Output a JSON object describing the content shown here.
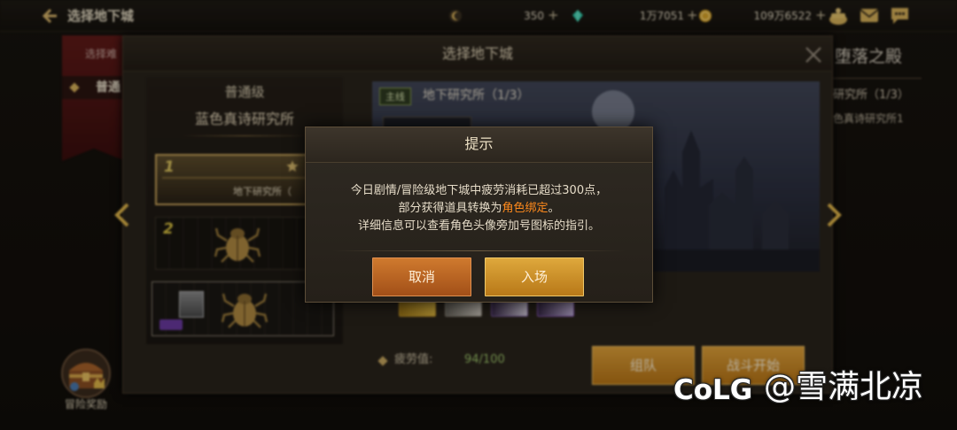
{
  "top_bar": {
    "title": "选择地下城",
    "currencies": [
      {
        "icon": "moon-coin-icon",
        "value": "350",
        "add": "+"
      },
      {
        "icon": "gem-icon",
        "value": "1万7051",
        "add": "+"
      },
      {
        "icon": "gold-coin-icon",
        "value": "109万6522",
        "add": "+"
      }
    ],
    "right_icons": [
      "treasure-pot-icon",
      "mail-icon",
      "chat-icon"
    ]
  },
  "left_banner": {
    "heading": "选择难",
    "difficulty": "普通"
  },
  "right_preview": {
    "title": "堕落之殿",
    "stage": "研究所（1/3）",
    "dungeon": "色真诗研究所1"
  },
  "dungeon_panel": {
    "title": "选择地下城",
    "difficulty": "普通级",
    "dungeon_name": "蓝色真诗研究所",
    "cards": [
      {
        "number": "1",
        "label": "地下研究所（"
      },
      {
        "number": "2"
      }
    ],
    "tag": "主线",
    "stage": "地下研究所（1/3）",
    "fatigue_label": "疲劳值:",
    "fatigue_value": "94/100",
    "party_button": "组队",
    "start_button": "战斗开始"
  },
  "reward": {
    "label": "冒险奖励"
  },
  "dialog": {
    "title": "提示",
    "line1": "今日剧情/冒险级地下城中疲劳消耗已超过300点，",
    "line2_prefix": "部分获得道具转换为",
    "line2_highlight": "角色绑定",
    "line2_suffix": "。",
    "line3": "详细信息可以查看角色头像旁加号图标的指引。",
    "cancel": "取消",
    "enter": "入场"
  },
  "watermark": {
    "logo": "CoLG",
    "handle": "@雪满北凉"
  },
  "colors": {
    "gold_accent": "#d9b25a",
    "highlight_orange": "#ff8a1c",
    "fatigue_value": "#9cc46a",
    "cancel_button": "#b8621e",
    "enter_button": "#c98a1c"
  }
}
